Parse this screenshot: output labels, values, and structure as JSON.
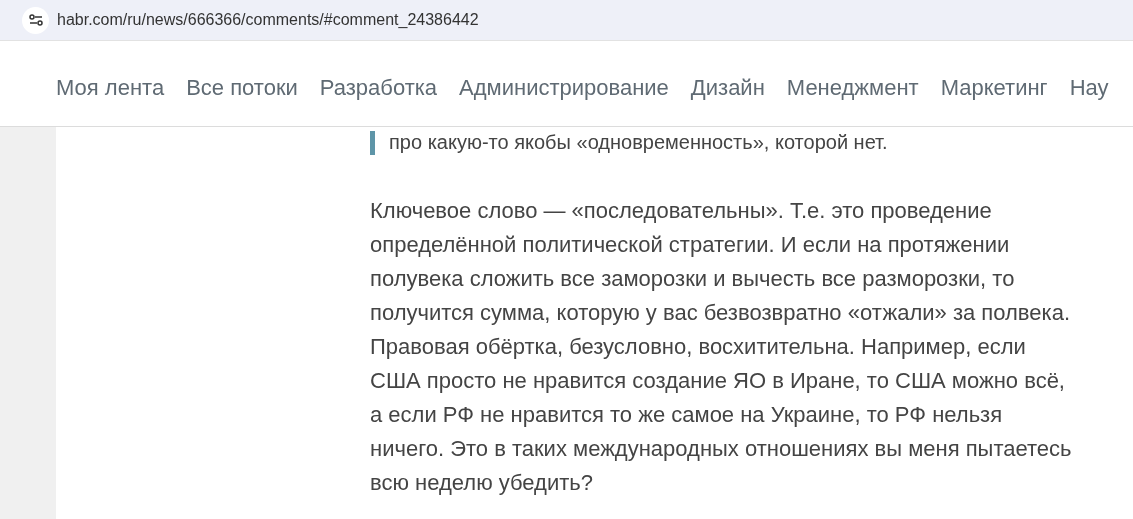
{
  "address_bar": {
    "url": "habr.com/ru/news/666366/comments/#comment_24386442"
  },
  "nav": {
    "items": [
      {
        "label": "Моя лента"
      },
      {
        "label": "Все потоки"
      },
      {
        "label": "Разработка"
      },
      {
        "label": "Администрирование"
      },
      {
        "label": "Дизайн"
      },
      {
        "label": "Менеджмент"
      },
      {
        "label": "Маркетинг"
      },
      {
        "label": "Нау"
      }
    ]
  },
  "comment": {
    "quote": "про какую-то якобы «одновременность», которой нет.",
    "text": "Ключевое слово — «последовательны». Т.е. это проведение определённой политической стратегии. И если на протяжении полувека сложить все заморозки и вычесть все разморозки, то получится сумма, которую у вас безвозвратно «отжали» за полвека. Правовая обёртка, безусловно, восхитительна. Например, если США просто не нравится создание ЯО в Иране, то США можно всё, а если РФ не нравится то же самое на Украине, то РФ нельзя ничего. Это в таких международных отношениях вы меня пытаетесь всю неделю убедить?"
  }
}
